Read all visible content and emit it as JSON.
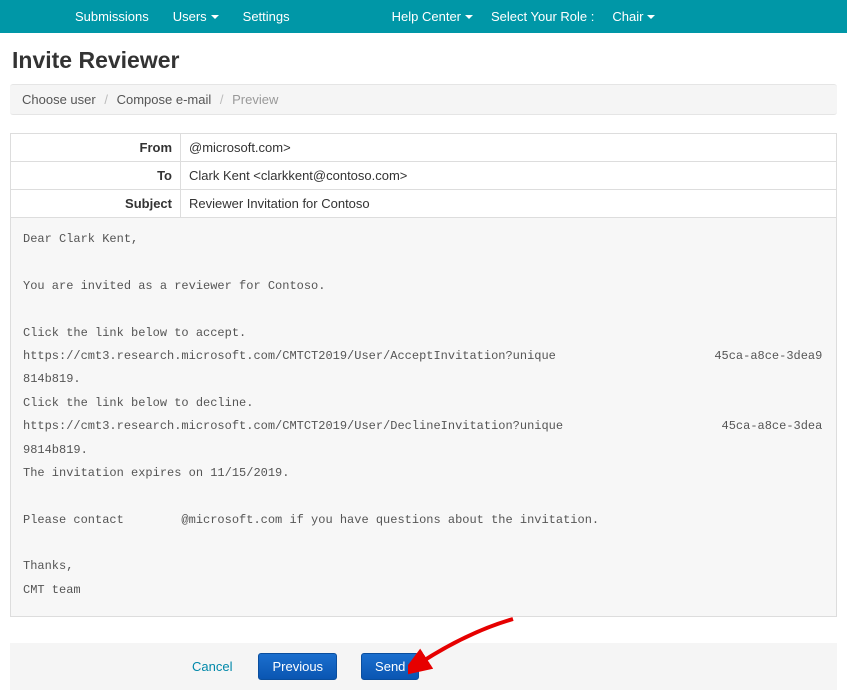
{
  "topbar": {
    "items": [
      {
        "label": "Submissions",
        "caret": false
      },
      {
        "label": "Users",
        "caret": true
      },
      {
        "label": "Settings",
        "caret": false
      }
    ],
    "help": "Help Center",
    "role_label": "Select Your Role :",
    "role_value": "Chair"
  },
  "page": {
    "title": "Invite Reviewer"
  },
  "breadcrumb": {
    "a": "Choose user",
    "b": "Compose e-mail",
    "c": "Preview"
  },
  "headers": {
    "from_label": "From",
    "from_value": "@microsoft.com>",
    "to_label": "To",
    "to_value": "Clark Kent <clarkkent@contoso.com>",
    "subject_label": "Subject",
    "subject_value": "Reviewer Invitation for Contoso"
  },
  "email_body": "Dear Clark Kent,\n\nYou are invited as a reviewer for Contoso.\n\nClick the link below to accept.\nhttps://cmt3.research.microsoft.com/CMTCT2019/User/AcceptInvitation?unique                      45ca-a8ce-3dea9814b819.\nClick the link below to decline.\nhttps://cmt3.research.microsoft.com/CMTCT2019/User/DeclineInvitation?unique                      45ca-a8ce-3dea9814b819.\nThe invitation expires on 11/15/2019.\n\nPlease contact        @microsoft.com if you have questions about the invitation.\n\nThanks,\nCMT team",
  "actions": {
    "cancel": "Cancel",
    "previous": "Previous",
    "send": "Send"
  }
}
